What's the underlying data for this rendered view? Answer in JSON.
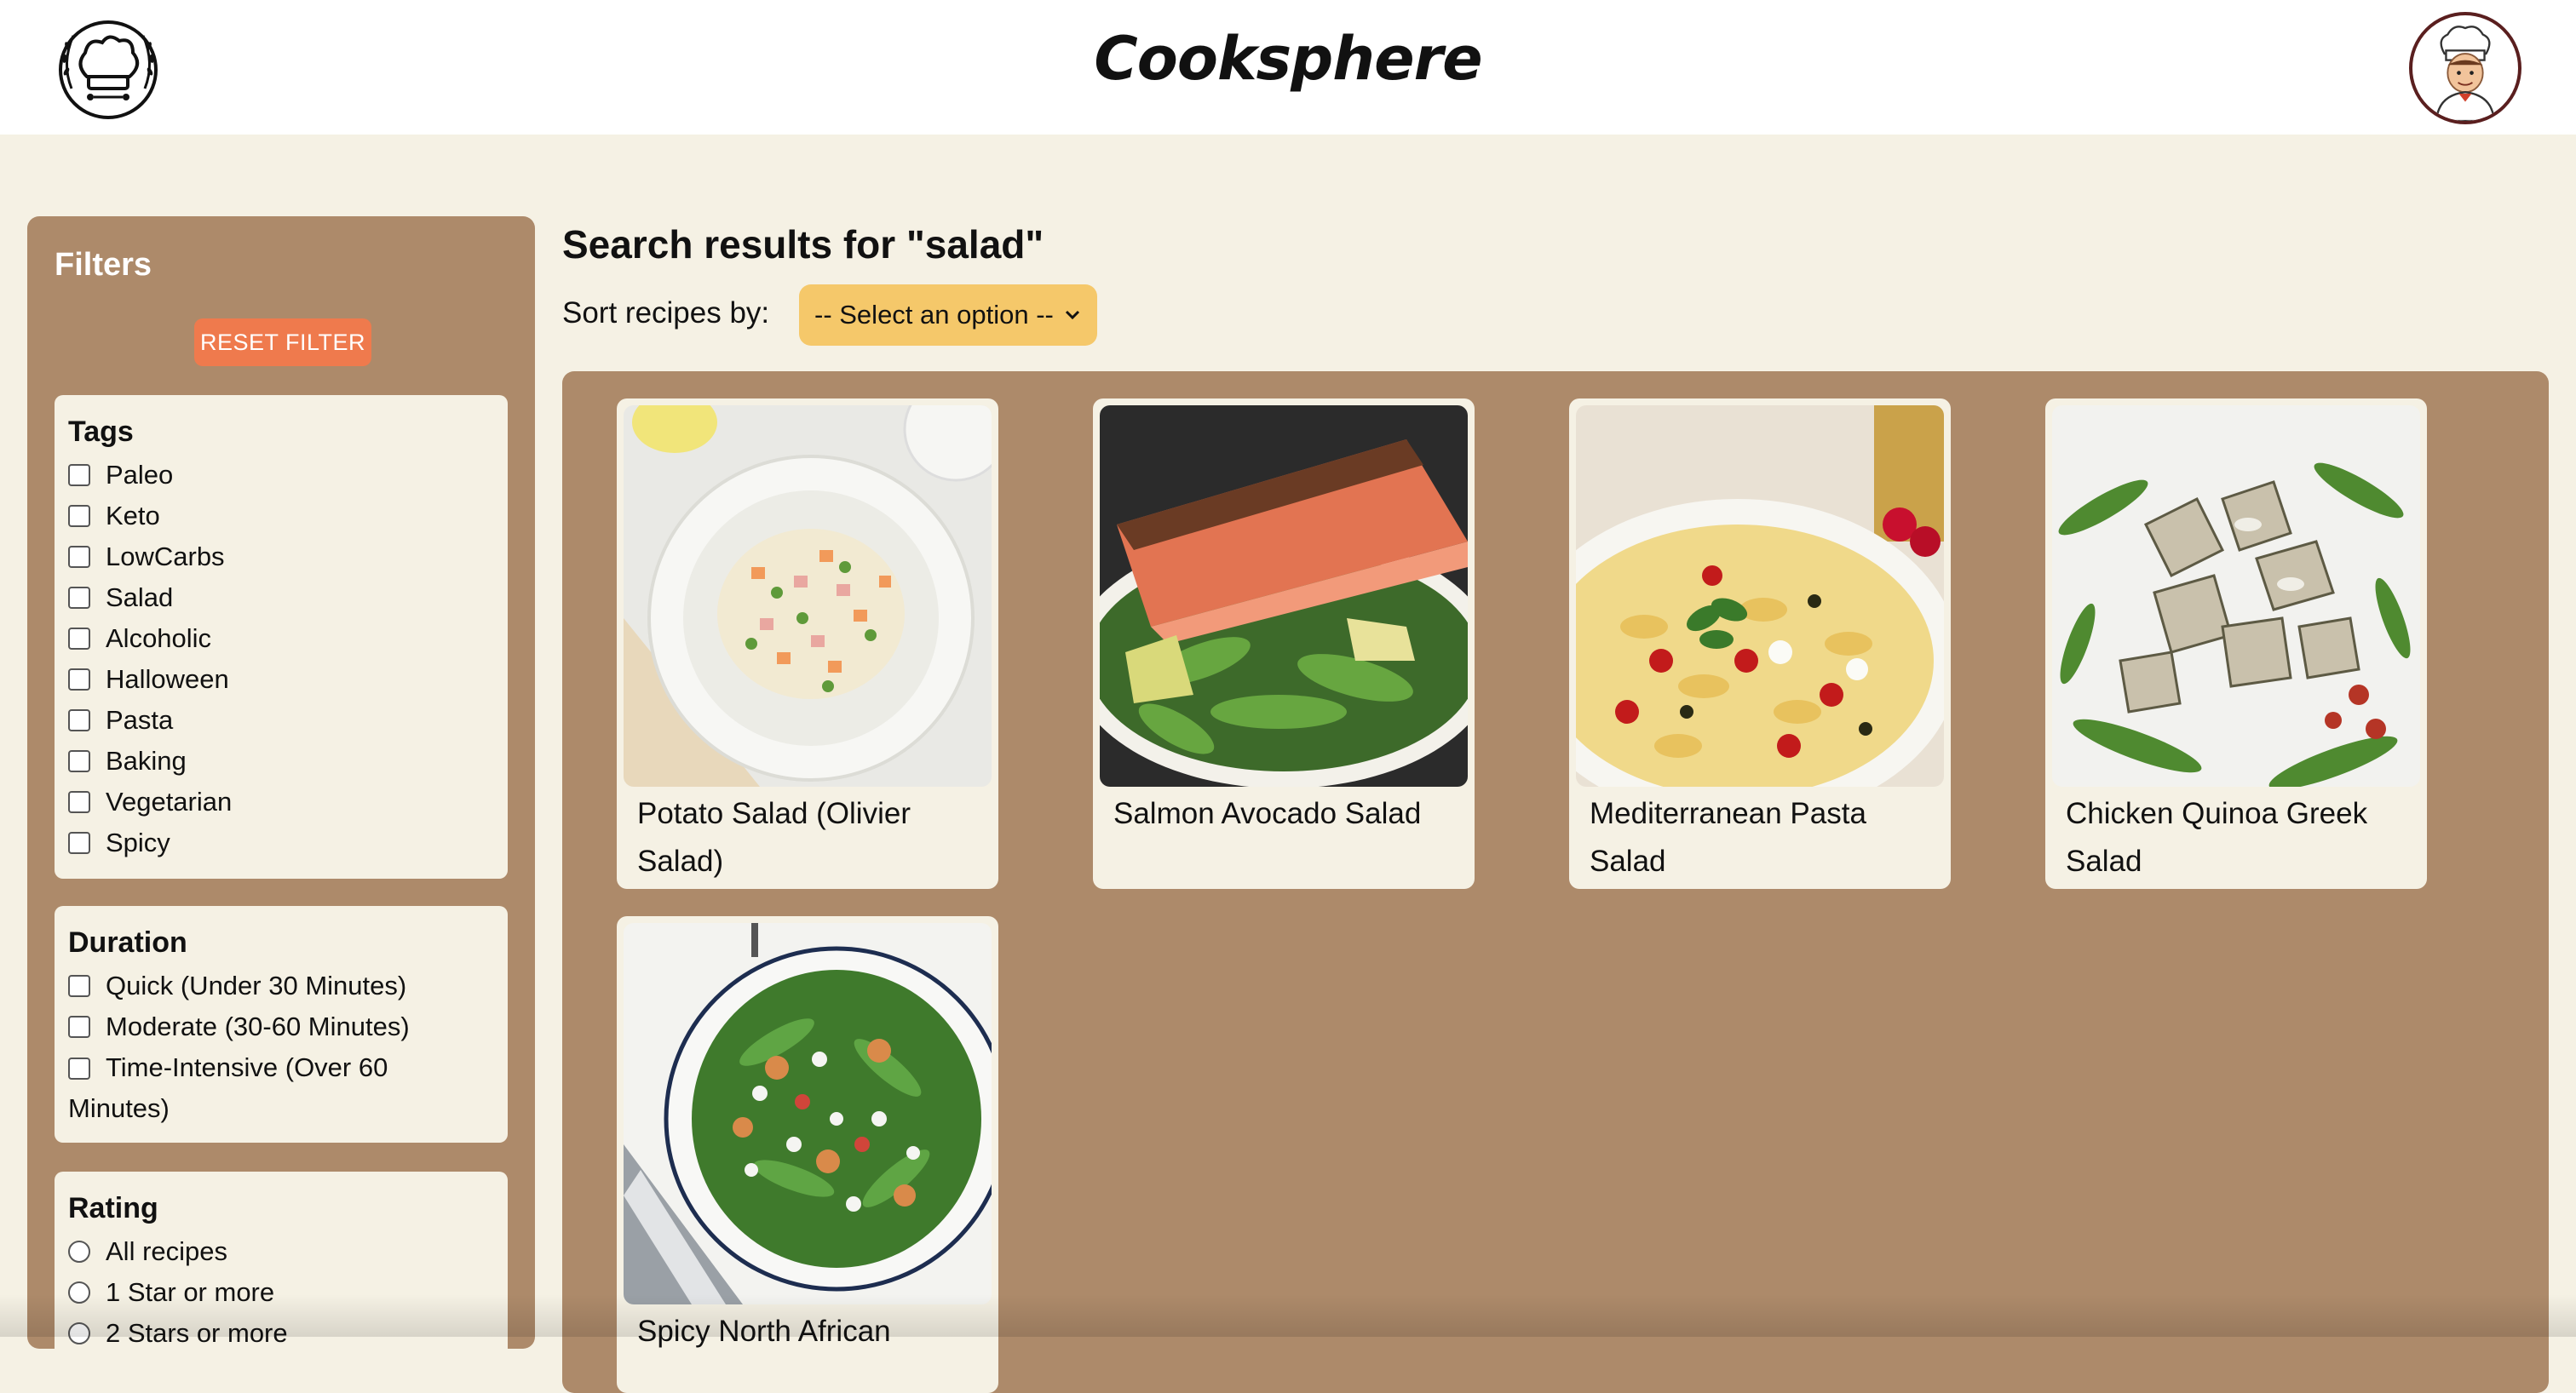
{
  "header": {
    "brand": "Cooksphere",
    "logo_icon": "chef-hat-logo-icon",
    "avatar_icon": "chef-avatar-icon"
  },
  "sidebar": {
    "title": "Filters",
    "reset_label": "RESET FILTER",
    "tags": {
      "heading": "Tags",
      "options": [
        "Paleo",
        "Keto",
        "LowCarbs",
        "Salad",
        "Alcoholic",
        "Halloween",
        "Pasta",
        "Baking",
        "Vegetarian",
        "Spicy"
      ]
    },
    "duration": {
      "heading": "Duration",
      "options": [
        "Quick (Under 30 Minutes)",
        "Moderate (30-60 Minutes)",
        "Time-Intensive (Over 60 Minutes)"
      ]
    },
    "rating": {
      "heading": "Rating",
      "options": [
        "All recipes",
        "1 Star or more",
        "2 Stars or more"
      ]
    }
  },
  "main": {
    "results_title": "Search results for \"salad\"",
    "sort_label": "Sort recipes by:",
    "sort_selected": "-- Select an option --",
    "recipes": [
      "Potato Salad (Olivier Salad)",
      "Salmon Avocado Salad",
      "Mediterranean Pasta Salad",
      "Chicken Quinoa Greek Salad",
      "Spicy North African"
    ]
  },
  "colors": {
    "page_bg": "#f5f1e4",
    "panel_bg": "#ad8a6a",
    "reset_button": "#ef7a4d",
    "sort_select": "#f5c86a"
  }
}
